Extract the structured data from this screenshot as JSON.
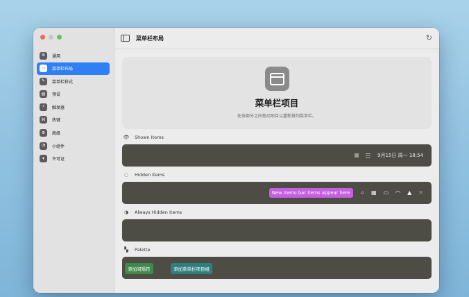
{
  "sidebar": {
    "items": [
      {
        "label": "通用",
        "icon": "gear-icon",
        "glyph": "⚙"
      },
      {
        "label": "菜单栏布局",
        "icon": "menubar-layout-icon",
        "glyph": "▭",
        "active": true
      },
      {
        "label": "菜单栏样式",
        "icon": "paintbrush-icon",
        "glyph": "✎"
      },
      {
        "label": "预设",
        "icon": "preset-icon",
        "glyph": "▤"
      },
      {
        "label": "触发器",
        "icon": "bolt-icon",
        "glyph": "⚡"
      },
      {
        "label": "热键",
        "icon": "keyboard-icon",
        "glyph": "⌘"
      },
      {
        "label": "高级",
        "icon": "gears-icon",
        "glyph": "⚙"
      },
      {
        "label": "小组件",
        "icon": "widget-icon",
        "glyph": "◔"
      },
      {
        "label": "许可证",
        "icon": "cart-icon",
        "glyph": "🛒"
      }
    ]
  },
  "header": {
    "title": "菜单栏布局"
  },
  "hero": {
    "title": "菜单栏项目",
    "subtitle": "在各部分之间拖动项目以重新排列菜单栏。"
  },
  "sections": {
    "shown": {
      "label": "Shown Items",
      "datetime": "9月15日 周一  18:54"
    },
    "hidden": {
      "label": "Hidden Items",
      "new_items_chip": "New menu bar items appear here"
    },
    "always_hidden": {
      "label": "Always Hidden Items"
    },
    "palette": {
      "label": "Palette",
      "add_spacer": "添加间隔符",
      "add_group": "添加菜单栏项目组"
    }
  },
  "colors": {
    "accent": "#2f7ff5",
    "bar": "#4d4d46",
    "purple_chip": "#c45fe0",
    "green_chip": "#3f8a4a",
    "teal_chip": "#2e7f7e"
  }
}
